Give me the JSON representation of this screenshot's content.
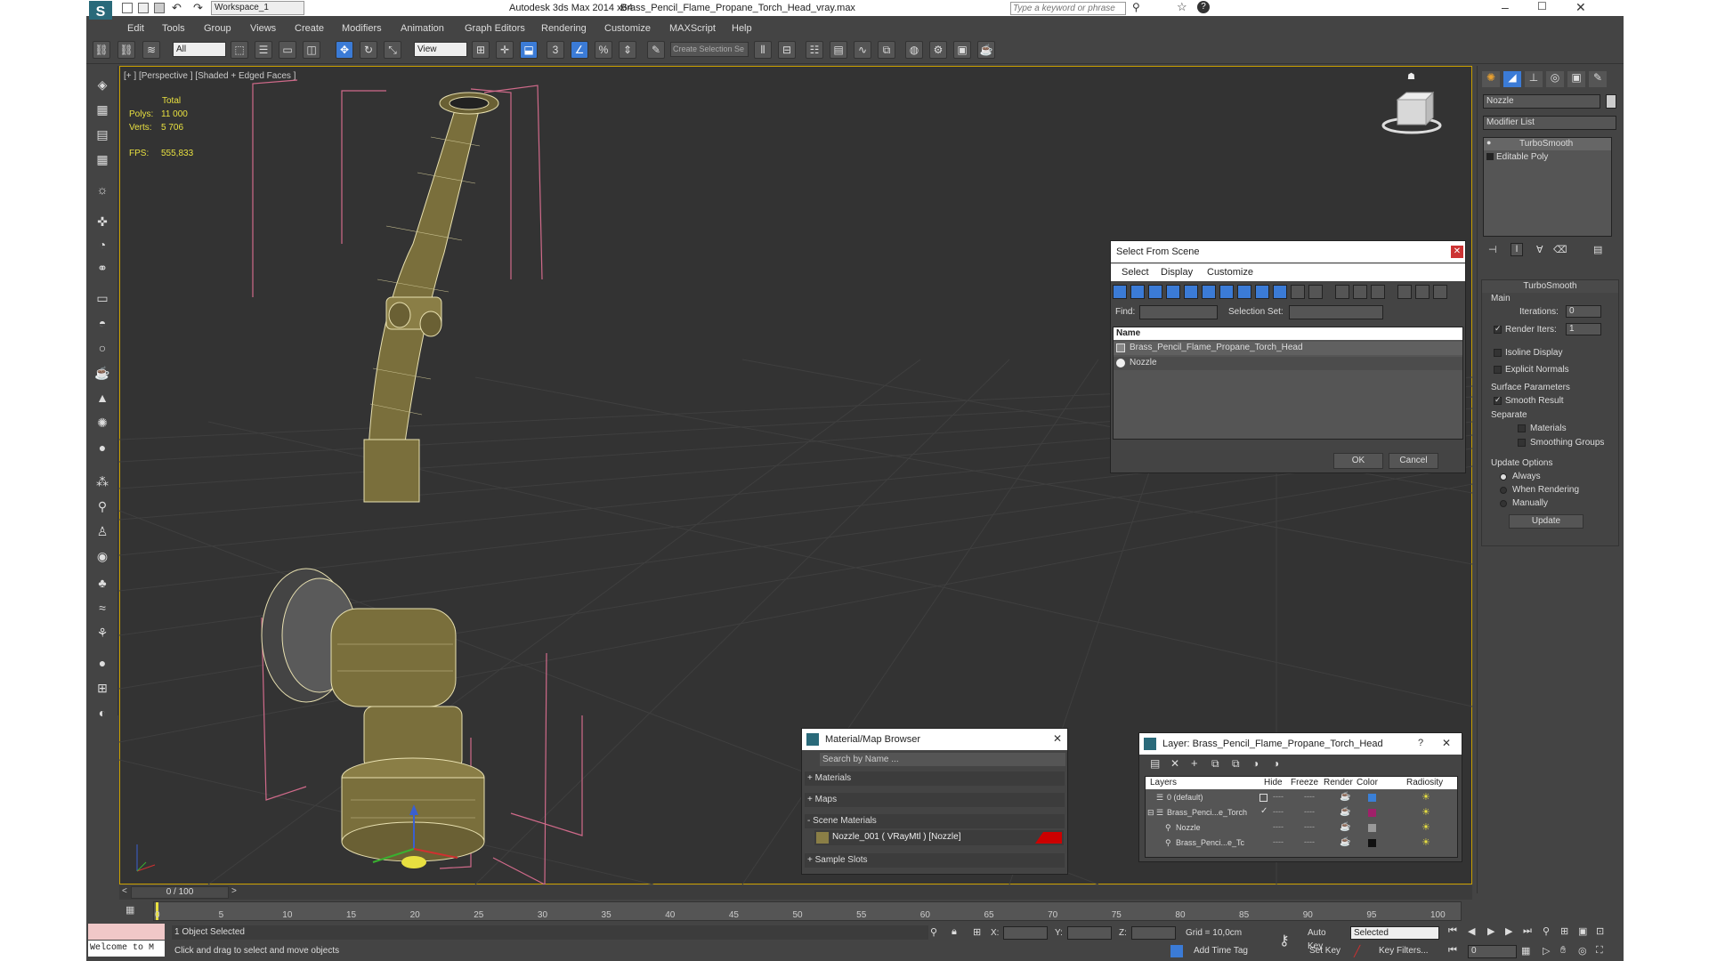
{
  "titlebar": {
    "workspace": "Workspace_1",
    "app_title": "Autodesk 3ds Max  2014 x64",
    "file_title": "Brass_Pencil_Flame_Propane_Torch_Head_vray.max",
    "search_placeholder": "Type a keyword or phrase"
  },
  "menu": [
    "Edit",
    "Tools",
    "Group",
    "Views",
    "Create",
    "Modifiers",
    "Animation",
    "Graph Editors",
    "Rendering",
    "Customize",
    "MAXScript",
    "Help"
  ],
  "toolbar": {
    "filter_select": "All",
    "ref_coord": "View",
    "named_selection": "Create Selection Se"
  },
  "viewport": {
    "label": "[+ ] [Perspective ] [Shaded + Edged Faces ]",
    "stats": {
      "total_label": "Total",
      "polys_label": "Polys:",
      "polys_value": "11 000",
      "verts_label": "Verts:",
      "verts_value": "5 706",
      "fps_label": "FPS:",
      "fps_value": "555,833"
    }
  },
  "command_panel": {
    "object_name": "Nozzle",
    "modifier_list": "Modifier List",
    "stack": [
      "TurboSmooth",
      "Editable Poly"
    ],
    "rollout_title": "TurboSmooth",
    "main_group": "Main",
    "iterations_label": "Iterations:",
    "iterations_value": "0",
    "render_iters_label": "Render Iters:",
    "render_iters_value": "1",
    "isoline_display": "Isoline Display",
    "explicit_normals": "Explicit Normals",
    "surface_params": "Surface Parameters",
    "smooth_result": "Smooth Result",
    "separate": "Separate",
    "materials": "Materials",
    "smoothing_groups": "Smoothing Groups",
    "update_options": "Update Options",
    "always": "Always",
    "when_rendering": "When Rendering",
    "manually": "Manually",
    "update_button": "Update"
  },
  "select_from_scene": {
    "title": "Select From Scene",
    "menu": [
      "Select",
      "Display",
      "Customize"
    ],
    "find_label": "Find:",
    "selection_set_label": "Selection Set:",
    "column_name": "Name",
    "items": [
      "Brass_Pencil_Flame_Propane_Torch_Head",
      "Nozzle"
    ],
    "ok": "OK",
    "cancel": "Cancel"
  },
  "material_browser": {
    "title": "Material/Map Browser",
    "search_placeholder": "Search by Name ...",
    "groups": [
      "+ Materials",
      "+ Maps",
      "- Scene Materials",
      "+ Sample Slots"
    ],
    "scene_material": "Nozzle_001  ( VRayMtl )  [Nozzle]"
  },
  "layer_dialog": {
    "title": "Layer: Brass_Pencil_Flame_Propane_Torch_Head",
    "help": "?",
    "columns": [
      "Layers",
      "Hide",
      "Freeze",
      "Render",
      "Color",
      "Radiosity"
    ],
    "rows": [
      {
        "name": "0 (default)",
        "color": "#3a7fd6"
      },
      {
        "name": "Brass_Penci...e_Torch",
        "color": "#a0206a"
      },
      {
        "name": "Nozzle",
        "color": "#999999"
      },
      {
        "name": "Brass_Penci...e_Tc",
        "color": "#111111"
      }
    ]
  },
  "timeline": {
    "frame_counter": "0 / 100",
    "ticks": [
      "0",
      "5",
      "10",
      "15",
      "20",
      "25",
      "30",
      "35",
      "40",
      "45",
      "50",
      "55",
      "60",
      "65",
      "70",
      "75",
      "80",
      "85",
      "90",
      "95",
      "100"
    ]
  },
  "status": {
    "listener": "Welcome to M",
    "selected": "1 Object Selected",
    "prompt": "Click and drag to select and move objects",
    "x_label": "X:",
    "y_label": "Y:",
    "z_label": "Z:",
    "grid": "Grid = 10,0cm",
    "auto_key": "Auto Key",
    "set_key": "Set Key",
    "key_mode": "Selected",
    "key_filters": "Key Filters...",
    "add_time_tag": "Add Time Tag",
    "frame": "0"
  }
}
